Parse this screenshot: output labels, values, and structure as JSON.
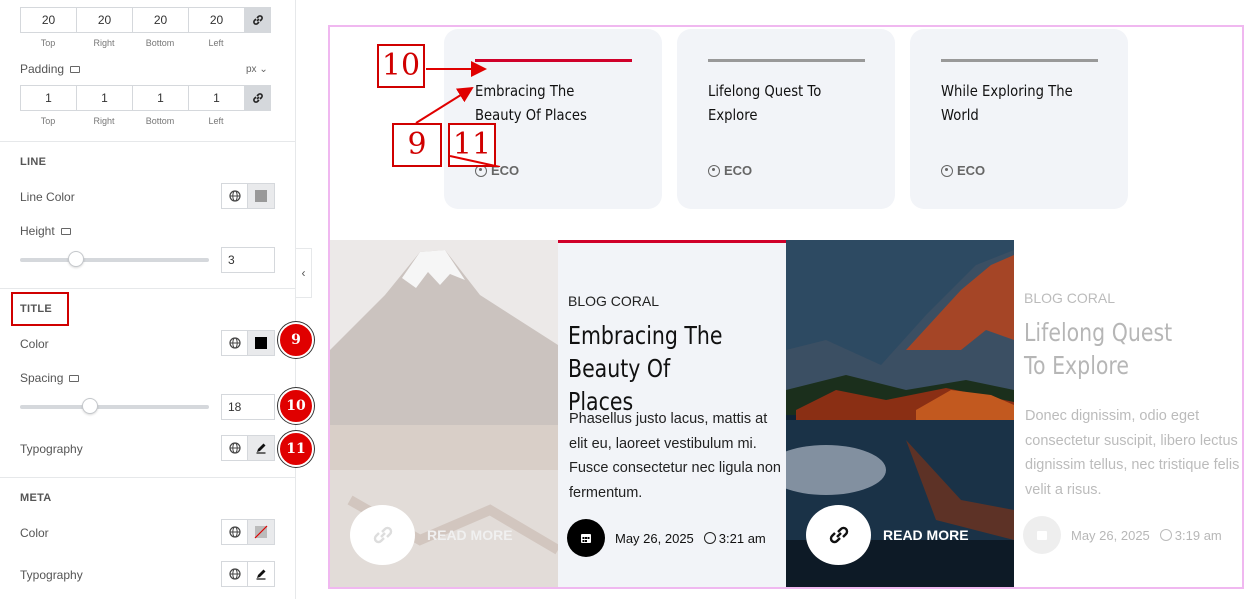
{
  "sidebar": {
    "margin": {
      "values": [
        "20",
        "20",
        "20",
        "20"
      ],
      "labels": [
        "Top",
        "Right",
        "Bottom",
        "Left"
      ]
    },
    "padding": {
      "label": "Padding",
      "unit": "px ⌄",
      "values": [
        "1",
        "1",
        "1",
        "1"
      ],
      "labels": [
        "Top",
        "Right",
        "Bottom",
        "Left"
      ]
    },
    "line": {
      "heading": "LINE",
      "color_label": "Line Color",
      "height_label": "Height",
      "height_value": "3",
      "height_fraction": 0.28
    },
    "title": {
      "heading": "TITLE",
      "color_label": "Color",
      "spacing_label": "Spacing",
      "spacing_value": "18",
      "spacing_fraction": 0.36,
      "typography_label": "Typography"
    },
    "meta": {
      "heading": "META",
      "color_label": "Color",
      "typography_label": "Typography"
    },
    "collapse_icon": "‹"
  },
  "annotations": {
    "circle_9": "9",
    "circle_10": "10",
    "circle_11": "11",
    "box_10": "10",
    "box_9": "9",
    "box_11": "11"
  },
  "cards": [
    {
      "title": "Embracing The Beauty Of Places",
      "meta": "ECO",
      "line_color": "#d0002a"
    },
    {
      "title": "Lifelong Quest To Explore",
      "meta": "ECO",
      "line_color": "#999999"
    },
    {
      "title": "While Exploring The World",
      "meta": "ECO",
      "line_color": "#999999"
    }
  ],
  "posts": [
    {
      "read_more": "READ MORE",
      "category": "BLOG CORAL",
      "title": "Embracing The Beauty Of Places",
      "excerpt": "Phasellus justo lacus, mattis at elit eu, laoreet vestibulum mi. Fusce consectetur nec ligula non fermentum.",
      "date": "May 26, 2025",
      "time": "3:21 am"
    },
    {
      "read_more": "READ MORE",
      "category": "BLOG CORAL",
      "title": "Lifelong Quest To Explore",
      "excerpt": "Donec dignissim, odio eget consectetur suscipit, libero lectus dignissim tellus, nec tristique felis velit a risus.",
      "date": "May 26, 2025",
      "time": "3:19 am"
    }
  ],
  "colors": {
    "accent": "#d0002a",
    "annotation_red": "#e00000",
    "preview_border": "#f0b8f0"
  }
}
